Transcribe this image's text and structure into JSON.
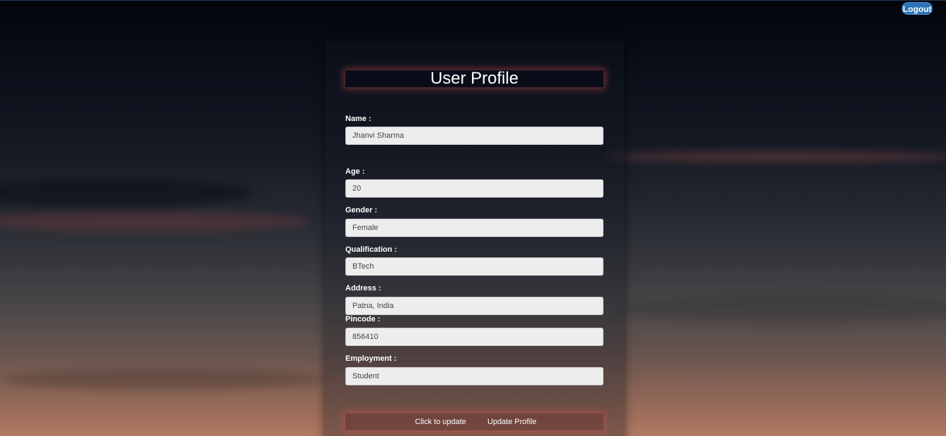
{
  "header": {
    "logout_label": "Logout"
  },
  "profile": {
    "title": "User Profile",
    "fields": {
      "name": {
        "label": "Name :",
        "value": "Jhanvi Sharma"
      },
      "age": {
        "label": "Age :",
        "value": "20"
      },
      "gender": {
        "label": "Gender :",
        "value": "Female"
      },
      "qualification": {
        "label": "Qualification :",
        "value": "BTech"
      },
      "address": {
        "label": "Address :",
        "value": "Patna, India"
      },
      "pincode": {
        "label": "Pincode :",
        "value": "856410"
      },
      "employment": {
        "label": "Employment :",
        "value": "Student"
      }
    },
    "action": {
      "hint": "Click to update",
      "button_label": "Update Profile"
    }
  },
  "colors": {
    "logout_bg": "#2b73b6",
    "title_bg": "#0a0d19",
    "glow": "#dc5050",
    "field_bg": "#ededed"
  }
}
